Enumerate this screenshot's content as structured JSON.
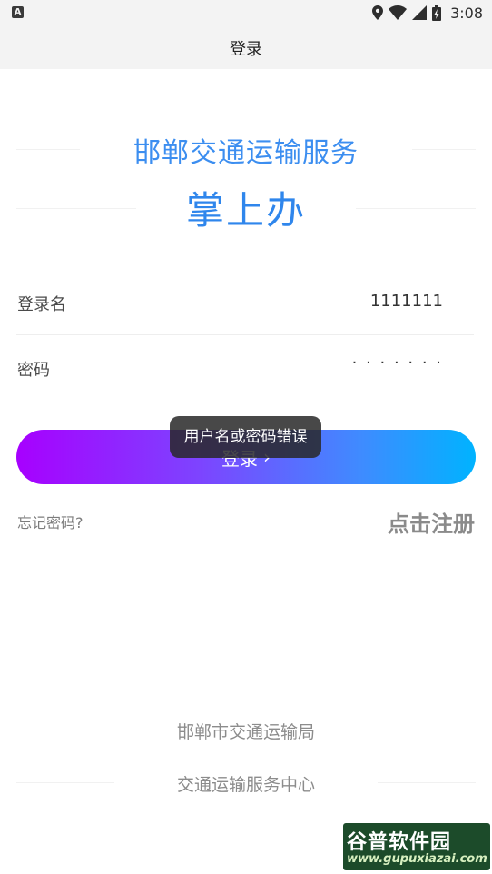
{
  "status_bar": {
    "left_icon": "A",
    "icons": [
      "location-icon",
      "wifi-icon",
      "signal-icon",
      "battery-icon"
    ],
    "time": "3:08"
  },
  "header": {
    "title": "登录"
  },
  "brand": {
    "subtitle": "邯郸交通运输服务",
    "title": "掌上办",
    "color": "#2f86ec"
  },
  "form": {
    "username_label": "登录名",
    "username_value": "1111111",
    "password_label": "密码",
    "password_value": "· · · · · · ·"
  },
  "login_button": {
    "label": "登录",
    "chevron": "›"
  },
  "toast": {
    "text": "用户名或密码错误"
  },
  "links": {
    "forgot": "忘记密码?",
    "register": "点击注册"
  },
  "footer": {
    "line1": "邯郸市交通运输局",
    "line2": "交通运输服务中心"
  },
  "watermark": {
    "top": "谷普软件园",
    "bottom": "www.gupuxiazai.com"
  },
  "colors": {
    "gradient_start": "#a700ff",
    "gradient_end": "#00b3ff",
    "toast_bg": "#282828"
  }
}
